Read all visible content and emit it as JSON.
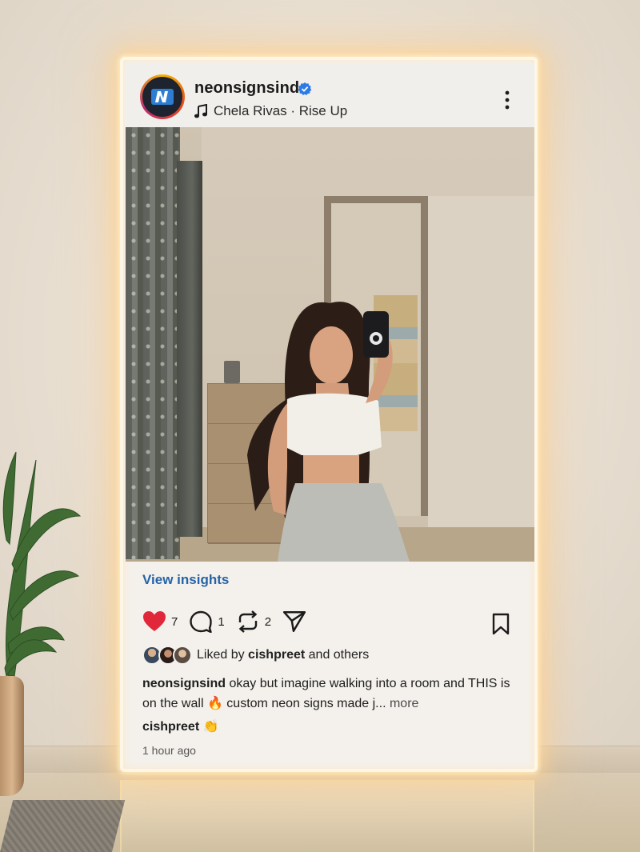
{
  "post": {
    "username": "neonsignsind",
    "verified_icon": "verified-badge-icon",
    "music": {
      "icon": "music-note-icon",
      "text": "Chela Rivas · Rise Up"
    },
    "menu_icon": "more-vertical-icon",
    "view_insights": "View insights",
    "actions": {
      "likes": "7",
      "comments": "1",
      "reposts": "2"
    },
    "liked_by": {
      "prefix": "Liked by",
      "user": "cishpreet",
      "suffix": "and others"
    },
    "caption": {
      "user": "neonsignsind",
      "text": "okay but imagine walking into a room and THIS is on the wall 🔥 custom neon signs made j...",
      "more": "more"
    },
    "comment": {
      "user": "cishpreet",
      "emoji": "👏"
    },
    "time": "1 hour ago"
  },
  "colors": {
    "link": "#2563a8",
    "like": "#e0283a",
    "neon_glow": "#ffd696"
  }
}
